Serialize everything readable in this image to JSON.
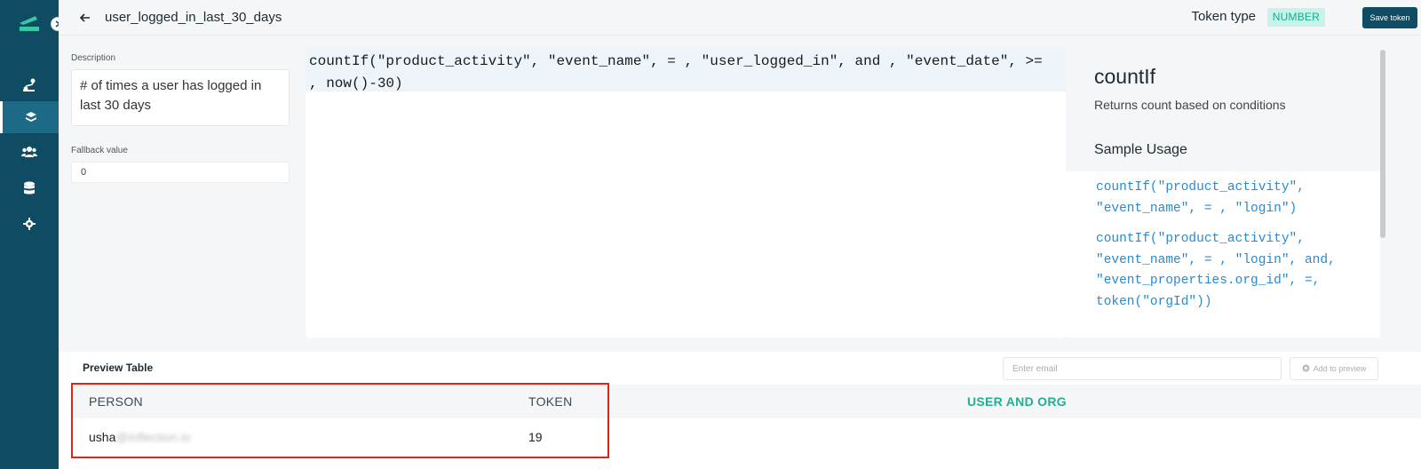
{
  "sidebar": {
    "items": [
      {
        "icon": "flow-icon",
        "active": false
      },
      {
        "icon": "token-icon",
        "active": true
      },
      {
        "icon": "users-icon",
        "active": false
      },
      {
        "icon": "database-icon",
        "active": false
      },
      {
        "icon": "gear-icon",
        "active": false
      }
    ],
    "colors": {
      "background": "#0f4c64",
      "active": "#1d6a86",
      "accent": "#20b08f"
    }
  },
  "header": {
    "title": "user_logged_in_last_30_days",
    "token_type_label": "Token type",
    "token_type_value": "NUMBER",
    "save_label": "Save token"
  },
  "form": {
    "description_label": "Description",
    "description_value": "# of times a user has logged in last 30 days",
    "fallback_label": "Fallback value",
    "fallback_value": "0"
  },
  "editor": {
    "code": "countIf(\"product_activity\", \"event_name\", = , \"user_logged_in\", and , \"event_date\", >= , now()-30)"
  },
  "help": {
    "function_name": "countIf",
    "function_description": "Returns count based on conditions",
    "sample_usage_label": "Sample Usage",
    "samples": [
      "countIf(\"product_activity\", \"event_name\", = , \"login\")",
      "countIf(\"product_activity\", \"event_name\", = , \"login\", and, \"event_properties.org_id\", =, token(\"orgId\"))"
    ]
  },
  "preview": {
    "title": "Preview Table",
    "email_placeholder": "Enter email",
    "add_label": "Add to preview",
    "columns": [
      "PERSON",
      "TOKEN",
      "USER AND ORG"
    ],
    "rows": [
      {
        "person_visible": "usha",
        "person_blurred": "@inflection.io",
        "token": "19"
      }
    ]
  }
}
